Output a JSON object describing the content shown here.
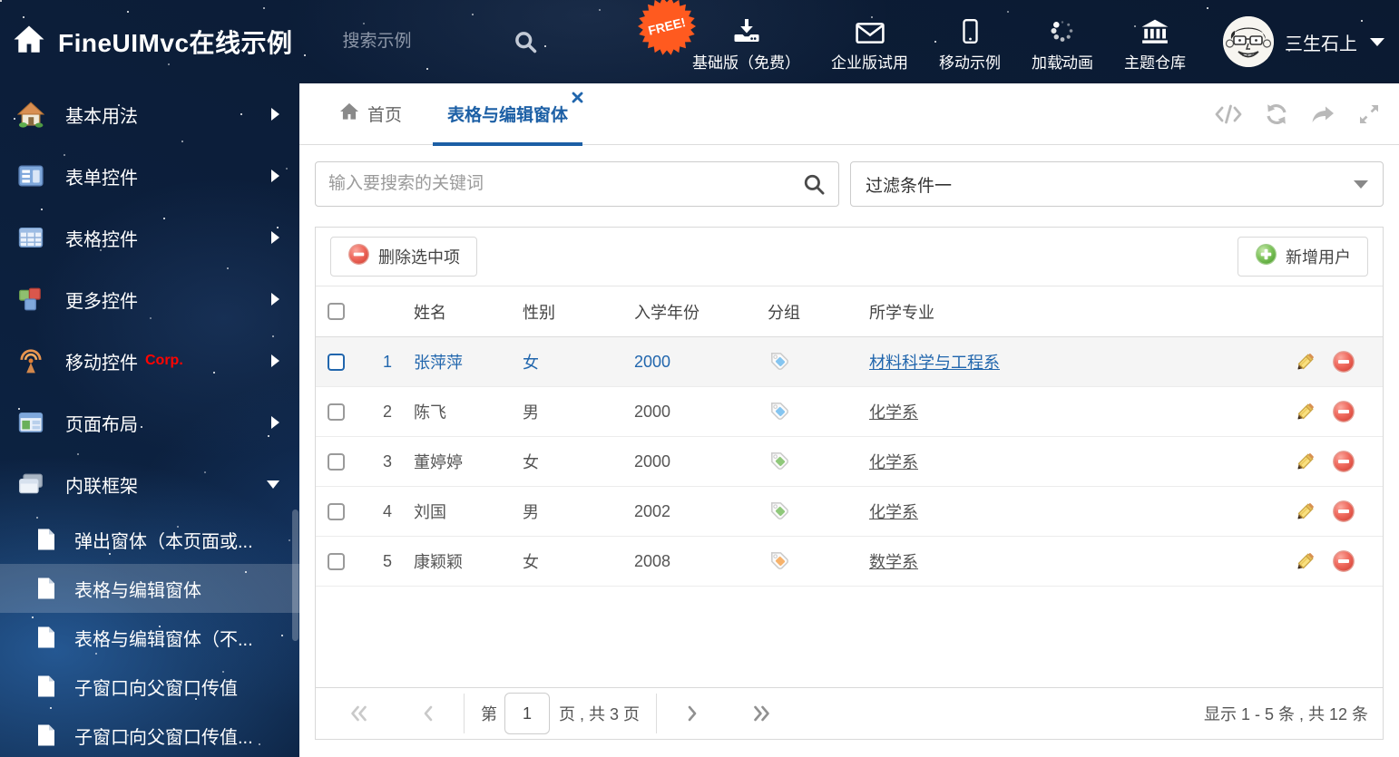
{
  "header": {
    "title": "FineUIMvc在线示例",
    "search_placeholder": "搜索示例",
    "free_badge": "FREE!",
    "nav_items": [
      {
        "label": "基础版（免费）",
        "icon": "download-icon"
      },
      {
        "label": "企业版试用",
        "icon": "envelope-icon"
      },
      {
        "label": "移动示例",
        "icon": "mobile-icon"
      },
      {
        "label": "加载动画",
        "icon": "spinner-icon"
      },
      {
        "label": "主题仓库",
        "icon": "bank-icon"
      }
    ],
    "user": {
      "name": "三生石上"
    }
  },
  "sidebar": {
    "items": [
      {
        "label": "基本用法",
        "icon": "house-icon",
        "state": "collapsed"
      },
      {
        "label": "表单控件",
        "icon": "form-icon",
        "state": "collapsed"
      },
      {
        "label": "表格控件",
        "icon": "grid-icon",
        "state": "collapsed"
      },
      {
        "label": "更多控件",
        "icon": "cubes-icon",
        "state": "collapsed"
      },
      {
        "label": "移动控件",
        "icon": "antenna-icon",
        "badge": "Corp.",
        "state": "collapsed"
      },
      {
        "label": "页面布局",
        "icon": "layout-icon",
        "state": "collapsed"
      },
      {
        "label": "内联框架",
        "icon": "frames-icon",
        "state": "expanded"
      }
    ],
    "subitems": [
      {
        "label": "弹出窗体（本页面或...",
        "selected": false
      },
      {
        "label": "表格与编辑窗体",
        "selected": true
      },
      {
        "label": "表格与编辑窗体（不...",
        "selected": false
      },
      {
        "label": "子窗口向父窗口传值",
        "selected": false
      },
      {
        "label": "子窗口向父窗口传值...",
        "selected": false
      }
    ]
  },
  "main": {
    "tabs": [
      {
        "label": "首页",
        "active": false
      },
      {
        "label": "表格与编辑窗体",
        "active": true,
        "closable": true
      }
    ],
    "search_placeholder": "输入要搜索的关键词",
    "filter_value": "过滤条件一",
    "toolbar": {
      "delete_label": "删除选中项",
      "add_label": "新增用户"
    },
    "table": {
      "columns": [
        "姓名",
        "性别",
        "入学年份",
        "分组",
        "所学专业"
      ],
      "rows": [
        {
          "index": "1",
          "name": "张萍萍",
          "gender": "女",
          "year": "2000",
          "tag_color": "#85c5f0",
          "major": "材料科学与工程系",
          "selected": true
        },
        {
          "index": "2",
          "name": "陈飞",
          "gender": "男",
          "year": "2000",
          "tag_color": "#85c5f0",
          "major": "化学系",
          "selected": false
        },
        {
          "index": "3",
          "name": "董婷婷",
          "gender": "女",
          "year": "2000",
          "tag_color": "#8fc87a",
          "major": "化学系",
          "selected": false
        },
        {
          "index": "4",
          "name": "刘国",
          "gender": "男",
          "year": "2002",
          "tag_color": "#8fc87a",
          "major": "化学系",
          "selected": false
        },
        {
          "index": "5",
          "name": "康颖颖",
          "gender": "女",
          "year": "2008",
          "tag_color": "#f7b26b",
          "major": "数学系",
          "selected": false
        }
      ]
    },
    "pagination": {
      "prefix": "第",
      "page_value": "1",
      "suffix": "页 , 共 3 页",
      "summary": "显示 1 - 5 条 , 共 12 条"
    }
  },
  "colors": {
    "accent_blue": "#1c5fa5",
    "selected_row_text": "#2166ad",
    "selected_row_bg": "#f5f5f5",
    "delete_red": "#e2574c",
    "add_green": "#6cba4e",
    "free_badge_orange": "#ff5a1f"
  }
}
